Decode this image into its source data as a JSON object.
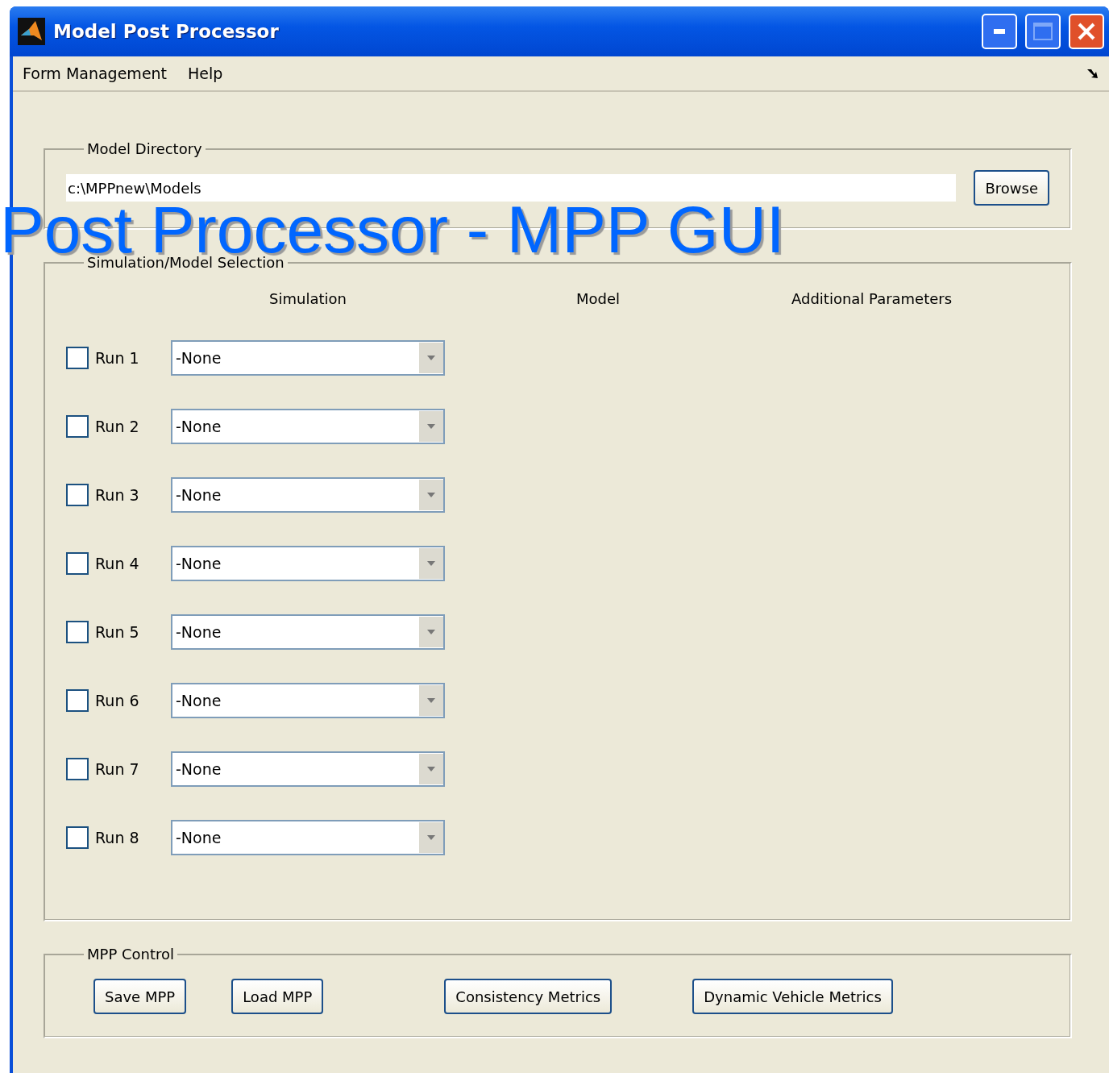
{
  "window": {
    "title": "Model Post Processor"
  },
  "menu": [
    "Form Management",
    "Help"
  ],
  "model_directory": {
    "label": "Model Directory",
    "value": "c:\\MPPnew\\Models",
    "browse": "Browse"
  },
  "selection": {
    "label": "Simulation/Model Selection",
    "columns": [
      "Simulation",
      "Model",
      "Additional Parameters"
    ],
    "runs": [
      {
        "label": "Run 1",
        "checked": false,
        "value": "-None"
      },
      {
        "label": "Run 2",
        "checked": false,
        "value": "-None"
      },
      {
        "label": "Run 3",
        "checked": false,
        "value": "-None"
      },
      {
        "label": "Run 4",
        "checked": false,
        "value": "-None"
      },
      {
        "label": "Run 5",
        "checked": false,
        "value": "-None"
      },
      {
        "label": "Run 6",
        "checked": false,
        "value": "-None"
      },
      {
        "label": "Run 7",
        "checked": false,
        "value": "-None"
      },
      {
        "label": "Run 8",
        "checked": false,
        "value": "-None"
      }
    ]
  },
  "control": {
    "label": "MPP Control",
    "buttons": [
      "Save MPP",
      "Load MPP",
      "Consistency Metrics",
      "Dynamic Vehicle Metrics"
    ]
  },
  "overlay_title": "Post Processor - MPP GUI"
}
